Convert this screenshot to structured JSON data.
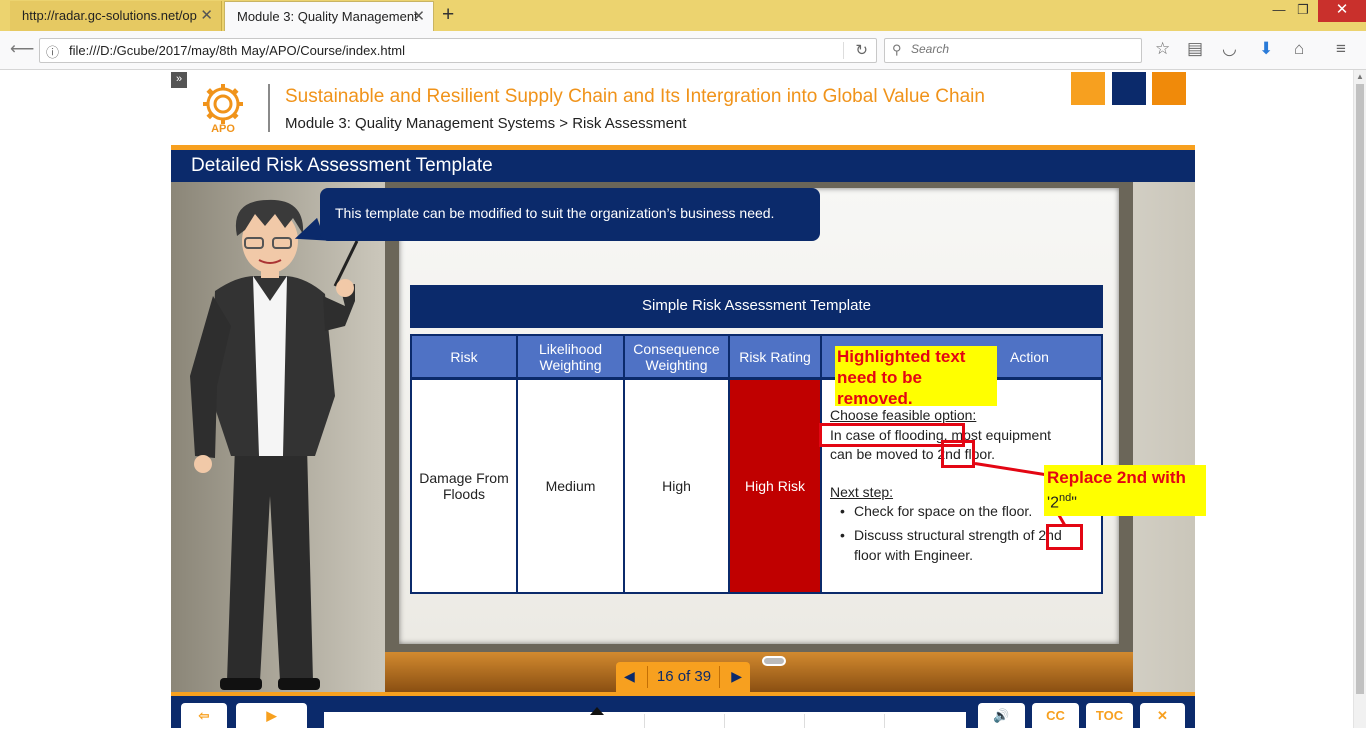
{
  "browser": {
    "tabs": [
      {
        "title": "http://radar.gc-solutions.net/op",
        "active": false
      },
      {
        "title": "Module 3: Quality Management",
        "active": true
      }
    ],
    "new_tab": "+",
    "url": "file:///D:/Gcube/2017/may/8th May/APO/Course/index.html",
    "search_placeholder": "Search"
  },
  "header": {
    "logo_text": "APO",
    "course_title": "Sustainable and Resilient Supply Chain and Its Intergration into Global Value Chain",
    "breadcrumb": "Module 3: Quality Management Systems > Risk Assessment",
    "accent_colors": [
      "#f7a01f",
      "#0b2a6b",
      "#f08a0a"
    ]
  },
  "slide": {
    "title": "Detailed Risk Assessment Template",
    "speech": "This template can be modified to suit the organization’s business need."
  },
  "table": {
    "title": "Simple Risk Assessment Template",
    "headers": [
      "Risk",
      "Likelihood Weighting",
      "Consequence Weighting",
      "Risk Rating",
      "Action"
    ],
    "row": {
      "risk": "Damage From Floods",
      "likelihood": "Medium",
      "consequence": "High",
      "rating": "High Risk",
      "action_heading": "Choose feasible option:",
      "action_line1": "In case of flooding, most equipment",
      "action_line2": "can be moved to 2nd floor.",
      "next_heading": "Next step:",
      "bullet1": "Check for space on the floor.",
      "bullet2a": "Discuss structural strength of 2nd",
      "bullet2b": "floor with Engineer."
    }
  },
  "annotations": {
    "note1": "Highlighted text need to be removed.",
    "note2_main": "Replace 2nd with",
    "note2_base": "2",
    "note2_sup": "nd",
    "note2_quote_open": "'",
    "note2_quote_close": "\""
  },
  "pager": {
    "label": "16 of 39",
    "prev_icon": "left-arrow-icon",
    "next_icon": "right-arrow-icon"
  },
  "bottom_controls": {
    "exit_icon": "exit-icon",
    "play_icon": "play-icon",
    "volume_icon": "volume-icon",
    "cc_label": "CC",
    "toc_label": "TOC",
    "close_icon": "close-icon"
  }
}
